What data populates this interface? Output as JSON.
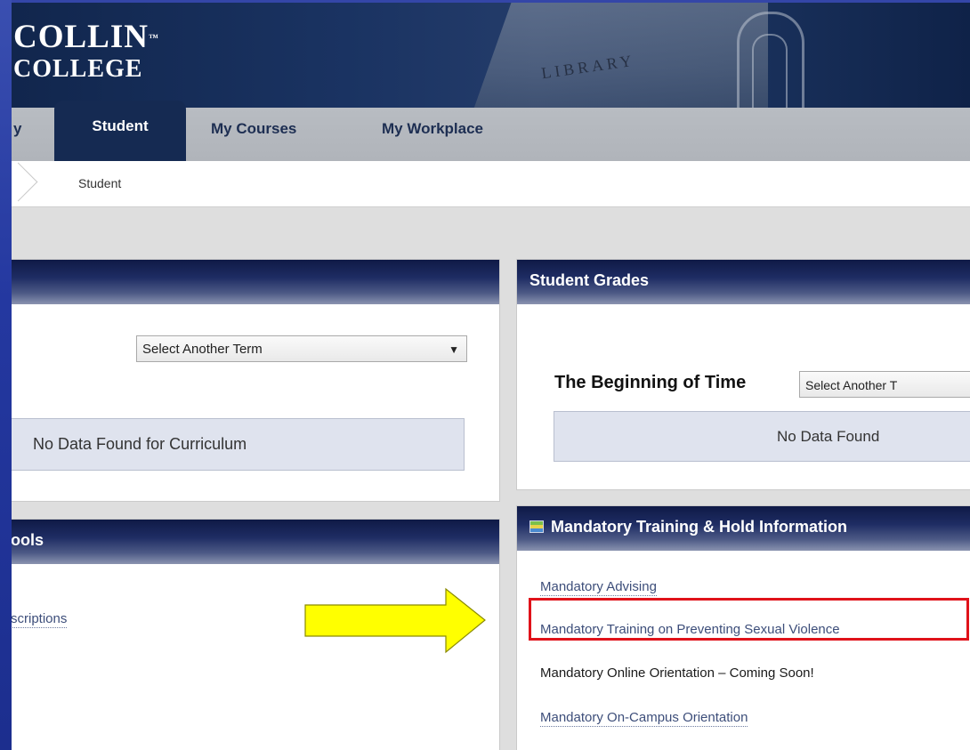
{
  "logo": {
    "line1": "COLLIN",
    "tm": "™",
    "line2": "COLLEGE"
  },
  "banner": {
    "building_sign": "LIBRARY"
  },
  "tabs": [
    {
      "label": "y"
    },
    {
      "label": "Student",
      "active": true
    },
    {
      "label": "My Courses"
    },
    {
      "label": "My Workplace"
    }
  ],
  "breadcrumb": {
    "current": "Student"
  },
  "left_panel_top": {
    "term_select": "Select Another Term",
    "no_data": "No Data Found for Curriculum"
  },
  "left_panel_bottom": {
    "title": "ools",
    "link": "scriptions"
  },
  "student_grades": {
    "title": "Student Grades",
    "term_label": "The Beginning of Time",
    "term_select": "Select Another T",
    "no_data": "No Data Found"
  },
  "mandatory": {
    "title": "Mandatory Training & Hold Information",
    "items": [
      {
        "label": "Mandatory Advising",
        "type": "link"
      },
      {
        "label": "Mandatory Training on Preventing Sexual Violence",
        "type": "link",
        "highlighted": true
      },
      {
        "label": "Mandatory Online Orientation – Coming Soon!",
        "type": "text"
      },
      {
        "label": "Mandatory On-Campus Orientation",
        "type": "link"
      }
    ]
  },
  "colors": {
    "header_navy": "#152a52",
    "highlight_red": "#e0121a",
    "arrow_yellow": "#ffff00",
    "frame_blue": "#2438a0"
  }
}
